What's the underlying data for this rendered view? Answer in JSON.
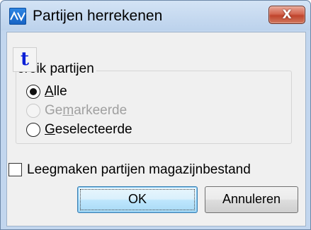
{
  "window": {
    "title": "Partijen herrekenen",
    "close_glyph": "X"
  },
  "group": {
    "icon_letter": "t",
    "label": "ereik partijen"
  },
  "radios": [
    {
      "pre": "",
      "accel": "A",
      "post": "lle",
      "checked": true,
      "disabled": false
    },
    {
      "pre": "Ge",
      "accel": "m",
      "post": "arkeerde",
      "checked": false,
      "disabled": true
    },
    {
      "pre": "",
      "accel": "G",
      "post": "eselecteerde",
      "checked": false,
      "disabled": false
    }
  ],
  "checkbox": {
    "label": "Leegmaken partijen magazijnbestand",
    "checked": false
  },
  "buttons": {
    "ok_label": "OK",
    "cancel_label": "Annuleren"
  },
  "icons": {
    "app": "mercator-av-icon",
    "close": "close-icon",
    "group": "t-icon"
  },
  "colors": {
    "title_bar": "#c2d6ee",
    "close_button": "#c7503a",
    "group_icon_letter": "#0a1fd6",
    "default_button": "#bee6fd"
  }
}
